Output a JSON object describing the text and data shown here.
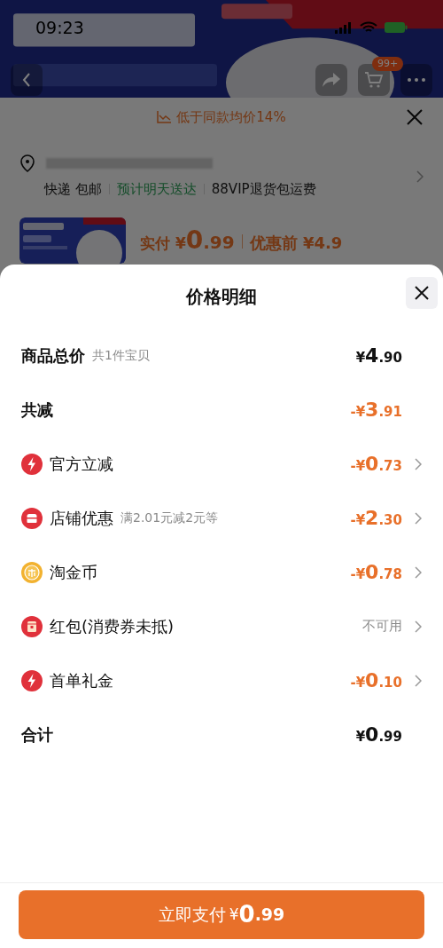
{
  "status_bar": {
    "time": "09:23"
  },
  "nav": {
    "cart_badge": "99+"
  },
  "order_sheet": {
    "promo": "低于同款均价14%",
    "shipping": [
      {
        "text": "快递 包邮",
        "highlight": false
      },
      {
        "text": "预计明天送达",
        "highlight": true
      },
      {
        "text": "88VIP退货包运费",
        "highlight": false
      }
    ],
    "price": {
      "label": "实付",
      "currency": "¥",
      "int": "0",
      "frac": ".99",
      "original": "优惠前 ¥4.9"
    }
  },
  "price_detail": {
    "title": "价格明细",
    "rows": [
      {
        "kind": "summary",
        "label": "商品总价",
        "note": "共1件宝贝",
        "value": {
          "kind": "amount",
          "prefix": "¥",
          "int": "4",
          "frac": ".90"
        },
        "chevron": false
      },
      {
        "kind": "summary",
        "label": "共减",
        "value": {
          "kind": "discount",
          "prefix": "-¥",
          "int": "3",
          "frac": ".91"
        },
        "chevron": false
      },
      {
        "kind": "bolt",
        "label": "官方立减",
        "value": {
          "kind": "discount",
          "prefix": "-¥",
          "int": "0",
          "frac": ".73"
        },
        "chevron": true
      },
      {
        "kind": "store",
        "label": "店铺优惠",
        "note": "满2.01元减2元等",
        "value": {
          "kind": "discount",
          "prefix": "-¥",
          "int": "2",
          "frac": ".30"
        },
        "chevron": true
      },
      {
        "kind": "coin",
        "label": "淘金币",
        "value": {
          "kind": "discount",
          "prefix": "-¥",
          "int": "0",
          "frac": ".78"
        },
        "chevron": true
      },
      {
        "kind": "envelope",
        "label": "红包(消费券未抵)",
        "value": {
          "kind": "text",
          "text": "不可用"
        },
        "chevron": true
      },
      {
        "kind": "bolt",
        "label": "首单礼金",
        "value": {
          "kind": "discount",
          "prefix": "-¥",
          "int": "0",
          "frac": ".10"
        },
        "chevron": true
      },
      {
        "kind": "summary",
        "label": "合计",
        "value": {
          "kind": "amount",
          "prefix": "¥",
          "int": "0",
          "frac": ".99"
        },
        "chevron": false
      }
    ],
    "pay_button": {
      "label": "立即支付",
      "currency": "¥",
      "int": "0",
      "frac": ".99"
    }
  }
}
